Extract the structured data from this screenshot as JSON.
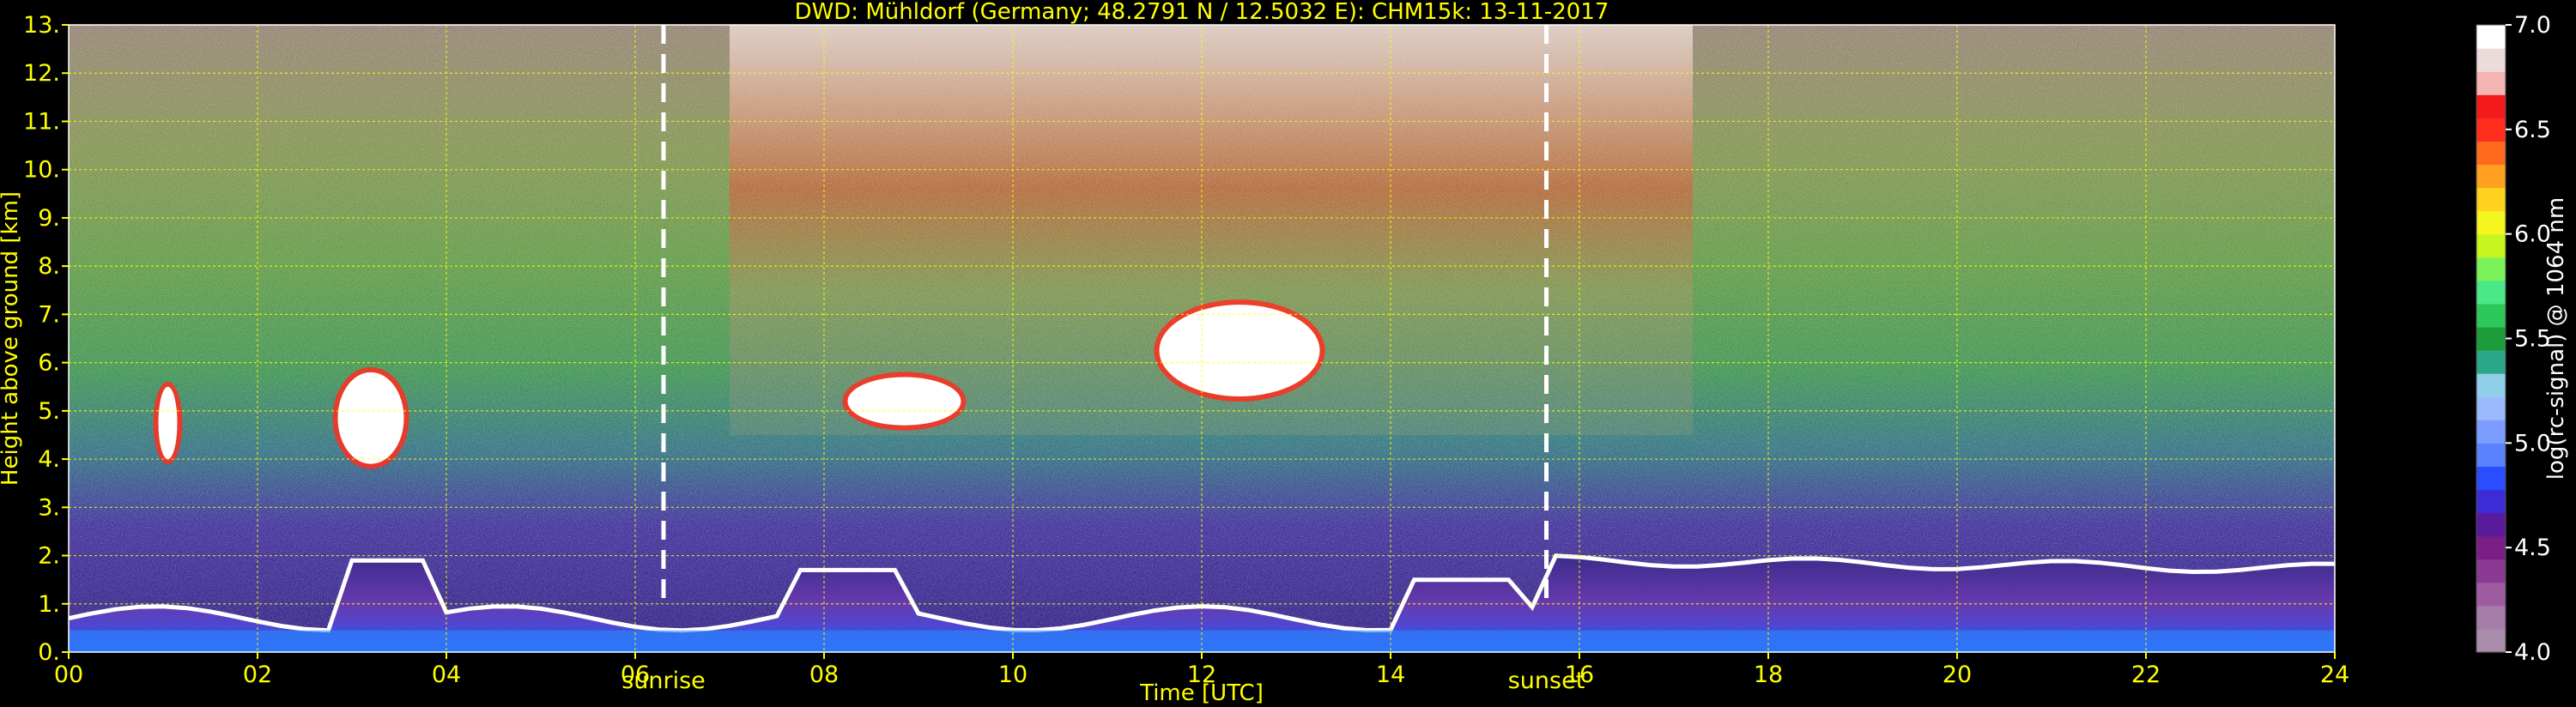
{
  "chart_data": {
    "type": "heatmap",
    "title": "DWD: Mühldorf (Germany; 48.2791 N / 12.5032 E):    CHM15k: 13-11-2017",
    "xlabel": "Time [UTC]",
    "ylabel": "Height above ground [km]",
    "xlim": [
      0,
      24
    ],
    "ylim": [
      0,
      13
    ],
    "x_ticks": [
      0,
      2,
      4,
      6,
      8,
      10,
      12,
      14,
      16,
      18,
      20,
      22,
      24
    ],
    "x_tick_labels": [
      "00",
      "02",
      "04",
      "06",
      "08",
      "10",
      "12",
      "14",
      "16",
      "18",
      "20",
      "22",
      "24"
    ],
    "y_ticks": [
      0,
      1,
      2,
      3,
      4,
      5,
      6,
      7,
      8,
      9,
      10,
      11,
      12,
      13
    ],
    "y_tick_labels": [
      "0.",
      "1.",
      "2.",
      "3.",
      "4.",
      "5.",
      "6.",
      "7.",
      "8.",
      "9.",
      "10.",
      "11.",
      "12.",
      "13."
    ],
    "grid": true,
    "grid_color": "#ffff00",
    "events": [
      {
        "label": "sunrise",
        "x": 6.3
      },
      {
        "label": "sunset",
        "x": 15.65
      }
    ],
    "colorbar": {
      "label": "log(rc-signal) @ 1064 nm",
      "range": [
        4.0,
        7.0
      ],
      "tick_values": [
        4.0,
        4.5,
        5.0,
        5.5,
        6.0,
        6.5,
        7.0
      ],
      "tick_labels": [
        "4.0",
        "4.5",
        "5.0",
        "5.5",
        "6.0",
        "6.5",
        "7.0"
      ],
      "colors": [
        "#a98ca9",
        "#a67ca8",
        "#9d5ca0",
        "#8a3a93",
        "#7a1f86",
        "#5a1a9c",
        "#3d2bd8",
        "#2a4dff",
        "#5a82ff",
        "#7c9cff",
        "#9cb8ff",
        "#8fd0e8",
        "#2ba88a",
        "#1e9c3c",
        "#2dc85a",
        "#4be888",
        "#7cf25a",
        "#c8f51e",
        "#f5f51e",
        "#ffd21e",
        "#ffa01e",
        "#ff6a1e",
        "#ff2e1e",
        "#f21a1a",
        "#f5b4b4",
        "#ebdcdc",
        "#ffffff"
      ]
    },
    "features": [
      {
        "kind": "boundary_layer_aerosol",
        "x_start": 0,
        "x_end": 24,
        "height_range_km": [
          0,
          2.1
        ],
        "value_range": [
          5.0,
          7.0
        ]
      },
      {
        "kind": "cloud",
        "x_range": [
          0.95,
          1.15
        ],
        "height_range_km": [
          4.0,
          5.5
        ],
        "value": 7.0
      },
      {
        "kind": "cloud",
        "x_range": [
          2.85,
          3.55
        ],
        "height_range_km": [
          3.9,
          5.8
        ],
        "value": 7.0
      },
      {
        "kind": "cloud",
        "x_range": [
          8.25,
          9.45
        ],
        "height_range_km": [
          4.7,
          5.7
        ],
        "value": 7.0
      },
      {
        "kind": "cloud",
        "x_range": [
          11.55,
          13.25
        ],
        "height_range_km": [
          5.3,
          7.2
        ],
        "value": 7.0
      }
    ]
  }
}
